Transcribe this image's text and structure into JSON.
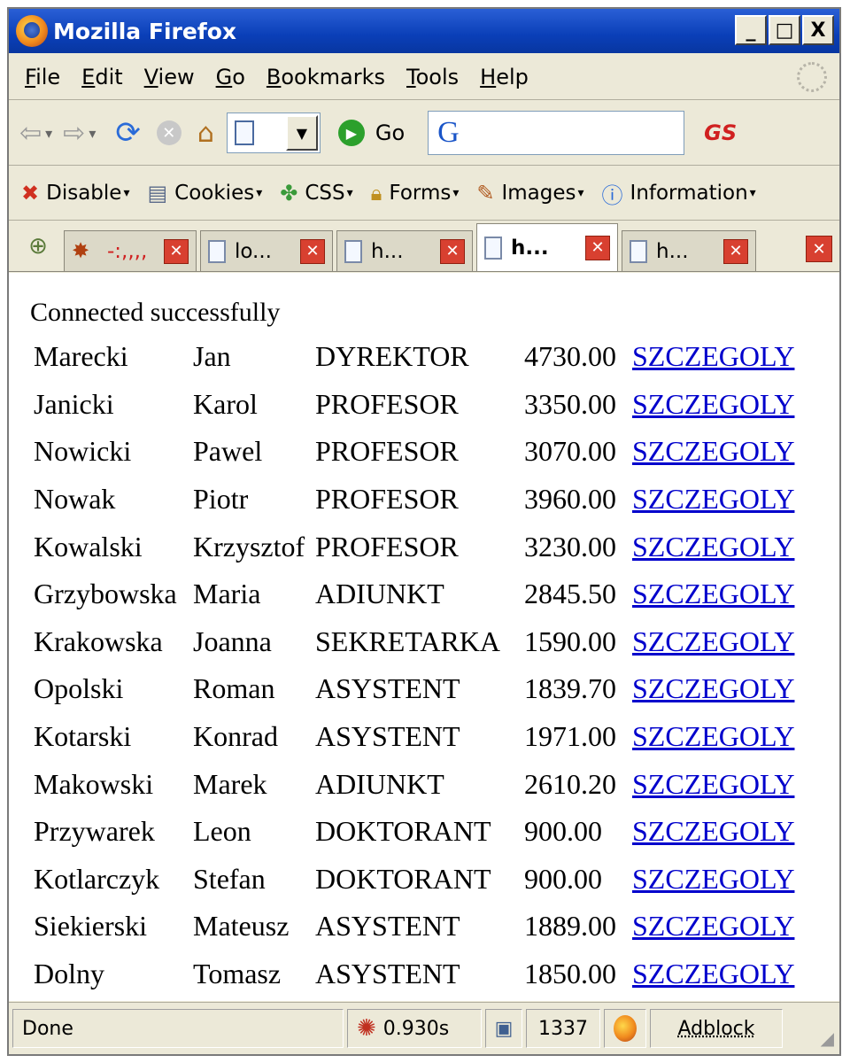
{
  "window": {
    "title": "Mozilla Firefox",
    "minimize": "_",
    "maximize": "□",
    "close": "X"
  },
  "menu": [
    "File",
    "Edit",
    "View",
    "Go",
    "Bookmarks",
    "Tools",
    "Help"
  ],
  "nav": {
    "go_label": "Go",
    "search_prefix": "G",
    "toolbar_gs": "GS"
  },
  "devbar": [
    "Disable",
    "Cookies",
    "CSS",
    "Forms",
    "Images",
    "Information"
  ],
  "tabs": [
    {
      "label": "-:,,,,"
    },
    {
      "label": "lo..."
    },
    {
      "label": "h..."
    },
    {
      "label": "h...",
      "active": true
    },
    {
      "label": "h..."
    }
  ],
  "content": {
    "message": "Connected successfully",
    "link_text": "SZCZEGOLY",
    "rows": [
      [
        "Marecki",
        "Jan",
        "DYREKTOR",
        "4730.00"
      ],
      [
        "Janicki",
        "Karol",
        "PROFESOR",
        "3350.00"
      ],
      [
        "Nowicki",
        "Pawel",
        "PROFESOR",
        "3070.00"
      ],
      [
        "Nowak",
        "Piotr",
        "PROFESOR",
        "3960.00"
      ],
      [
        "Kowalski",
        "Krzysztof",
        "PROFESOR",
        "3230.00"
      ],
      [
        "Grzybowska",
        "Maria",
        "ADIUNKT",
        "2845.50"
      ],
      [
        "Krakowska",
        "Joanna",
        "SEKRETARKA",
        "1590.00"
      ],
      [
        "Opolski",
        "Roman",
        "ASYSTENT",
        "1839.70"
      ],
      [
        "Kotarski",
        "Konrad",
        "ASYSTENT",
        "1971.00"
      ],
      [
        "Makowski",
        "Marek",
        "ADIUNKT",
        "2610.20"
      ],
      [
        "Przywarek",
        "Leon",
        "DOKTORANT",
        "900.00"
      ],
      [
        "Kotlarczyk",
        "Stefan",
        "DOKTORANT",
        "900.00"
      ],
      [
        "Siekierski",
        "Mateusz",
        "ASYSTENT",
        "1889.00"
      ],
      [
        "Dolny",
        "Tomasz",
        "ASYSTENT",
        "1850.00"
      ]
    ]
  },
  "status": {
    "text": "Done",
    "timer": "0.930s",
    "count": "1337",
    "adblock": "Adblock"
  }
}
